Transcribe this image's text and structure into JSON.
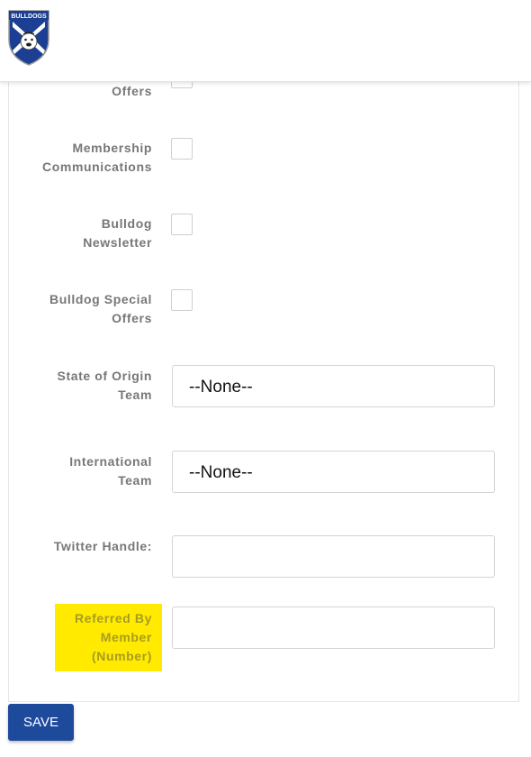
{
  "header": {
    "logo_text": "BULLDOGS"
  },
  "form": {
    "rows": [
      {
        "label_lines": [
          "Offers"
        ],
        "type": "checkbox"
      },
      {
        "label_lines": [
          "Membership",
          "Communications"
        ],
        "type": "checkbox"
      },
      {
        "label_lines": [
          "Bulldog",
          "Newsletter"
        ],
        "type": "checkbox"
      },
      {
        "label_lines": [
          "Bulldog Special",
          "Offers"
        ],
        "type": "checkbox"
      },
      {
        "label_lines": [
          "State of Origin",
          "Team"
        ],
        "type": "select",
        "value": "--None--"
      },
      {
        "label_lines": [
          "International",
          "Team"
        ],
        "type": "select",
        "value": "--None--"
      },
      {
        "label_lines": [
          "Twitter Handle:"
        ],
        "type": "text",
        "value": ""
      },
      {
        "label_lines": [
          "Referred By",
          "Member",
          "(Number)"
        ],
        "type": "text",
        "value": "",
        "highlighted": true
      }
    ]
  },
  "actions": {
    "save_label": "SAVE"
  },
  "colors": {
    "save_button": "#1e4a9c",
    "highlight": "#ffea00",
    "label_text": "#777777"
  }
}
